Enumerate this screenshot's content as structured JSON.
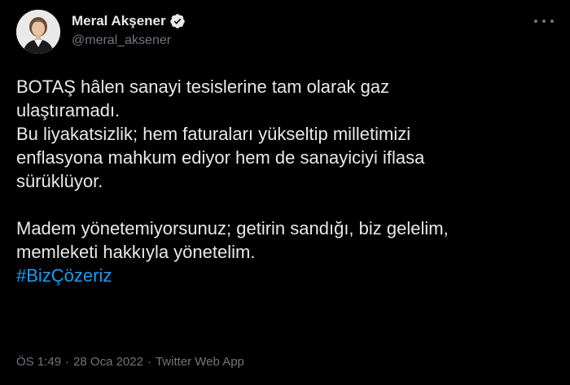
{
  "author": {
    "display_name": "Meral Akşener",
    "handle": "@meral_aksener",
    "verified": true,
    "avatar_icon": "profile-photo"
  },
  "tweet": {
    "paragraph1": [
      "BOTAŞ hâlen sanayi tesislerine tam olarak gaz",
      "ulaştıramadı.",
      "Bu liyakatsizlik; hem faturaları yükseltip milletimizi",
      "enflasyona mahkum ediyor hem de sanayiciyi iflasa",
      "sürüklüyor."
    ],
    "paragraph2": [
      "Madem yönetemiyorsunuz; getirin sandığı, biz gelelim,",
      "memleketi hakkıyla yönetelim."
    ],
    "hashtag": "#BizÇözeriz"
  },
  "meta": {
    "time": "ÖS 1:49",
    "date": "28 Oca 2022",
    "separator": "·",
    "source": "Twitter Web App"
  },
  "colors": {
    "background": "#000000",
    "text": "#e7e9ea",
    "muted": "#71767b",
    "accent": "#1d9bf0"
  },
  "icons": {
    "verified": "verified-badge-icon",
    "more": "more-options-icon"
  }
}
